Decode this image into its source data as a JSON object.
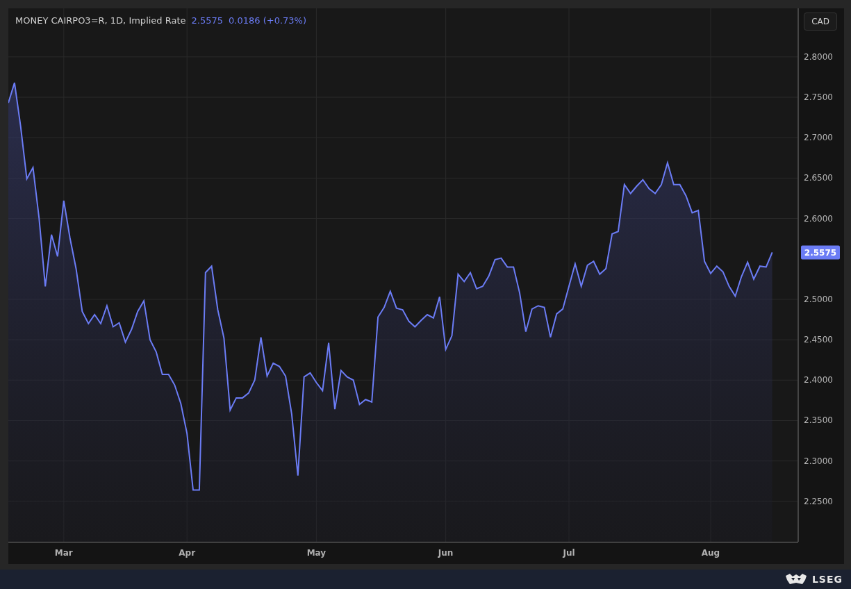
{
  "header": {
    "title": "MONEY CAIRPO3=R, 1D, Implied Rate",
    "value": "2.5575",
    "change": "0.0186 (+0.73%)"
  },
  "currency_button": "CAD",
  "last_value_tag": "2.5575",
  "chart_data": {
    "type": "area",
    "grid": true,
    "ylim": [
      2.2,
      2.86
    ],
    "categories": [
      null,
      null,
      null,
      null,
      null,
      null,
      null,
      null,
      null,
      "Mar",
      null,
      null,
      null,
      null,
      null,
      null,
      null,
      null,
      null,
      null,
      null,
      null,
      null,
      null,
      null,
      null,
      null,
      null,
      null,
      "Apr",
      null,
      null,
      null,
      null,
      null,
      null,
      null,
      null,
      null,
      null,
      null,
      null,
      null,
      null,
      null,
      null,
      null,
      null,
      null,
      null,
      "May",
      null,
      null,
      null,
      null,
      null,
      null,
      null,
      null,
      null,
      null,
      null,
      null,
      null,
      null,
      null,
      null,
      null,
      null,
      null,
      null,
      "Jun",
      null,
      null,
      null,
      null,
      null,
      null,
      null,
      null,
      null,
      null,
      null,
      null,
      null,
      null,
      null,
      null,
      null,
      null,
      null,
      "Jul",
      null,
      null,
      null,
      null,
      null,
      null,
      null,
      null,
      null,
      null,
      null,
      null,
      null,
      null,
      null,
      null,
      null,
      null,
      null,
      null,
      null,
      null,
      "Aug",
      null,
      null,
      null,
      null,
      null,
      null,
      null,
      null,
      null,
      null
    ],
    "yticks": [
      {
        "value": 2.8,
        "label": "2.8000"
      },
      {
        "value": 2.75,
        "label": "2.7500"
      },
      {
        "value": 2.7,
        "label": "2.7000"
      },
      {
        "value": 2.65,
        "label": "2.6500"
      },
      {
        "value": 2.6,
        "label": "2.6000"
      },
      {
        "value": 2.5,
        "label": "2.5000"
      },
      {
        "value": 2.45,
        "label": "2.4500"
      },
      {
        "value": 2.4,
        "label": "2.4000"
      },
      {
        "value": 2.35,
        "label": "2.3500"
      },
      {
        "value": 2.3,
        "label": "2.3000"
      },
      {
        "value": 2.25,
        "label": "2.2500"
      }
    ],
    "series": [
      {
        "color": "#6b7cf5",
        "values": [
          2.743,
          2.768,
          2.714,
          2.649,
          2.663,
          2.6,
          2.516,
          2.58,
          2.553,
          2.622,
          2.576,
          2.538,
          2.485,
          2.47,
          2.481,
          2.47,
          2.492,
          2.466,
          2.471,
          2.447,
          2.463,
          2.485,
          2.498,
          2.45,
          2.435,
          2.407,
          2.407,
          2.394,
          2.371,
          2.334,
          2.264,
          2.264,
          2.533,
          2.541,
          2.487,
          2.452,
          2.363,
          2.378,
          2.378,
          2.384,
          2.4,
          2.453,
          2.405,
          2.421,
          2.417,
          2.405,
          2.358,
          2.282,
          2.404,
          2.409,
          2.397,
          2.387,
          2.446,
          2.364,
          2.412,
          2.404,
          2.4,
          2.37,
          2.376,
          2.373,
          2.478,
          2.49,
          2.51,
          2.489,
          2.487,
          2.473,
          2.466,
          2.474,
          2.481,
          2.477,
          2.503,
          2.438,
          2.455,
          2.531,
          2.522,
          2.533,
          2.513,
          2.516,
          2.529,
          2.549,
          2.551,
          2.54,
          2.54,
          2.508,
          2.46,
          2.488,
          2.492,
          2.49,
          2.453,
          2.482,
          2.488,
          2.516,
          2.544,
          2.516,
          2.542,
          2.547,
          2.531,
          2.538,
          2.581,
          2.584,
          2.642,
          2.631,
          2.64,
          2.648,
          2.637,
          2.631,
          2.642,
          2.669,
          2.642,
          2.642,
          2.628,
          2.607,
          2.61,
          2.547,
          2.532,
          2.541,
          2.534,
          2.516,
          2.504,
          2.528,
          2.546,
          2.525,
          2.541,
          2.54,
          2.558
        ]
      }
    ]
  },
  "footer": {
    "brand": "LSEG"
  }
}
